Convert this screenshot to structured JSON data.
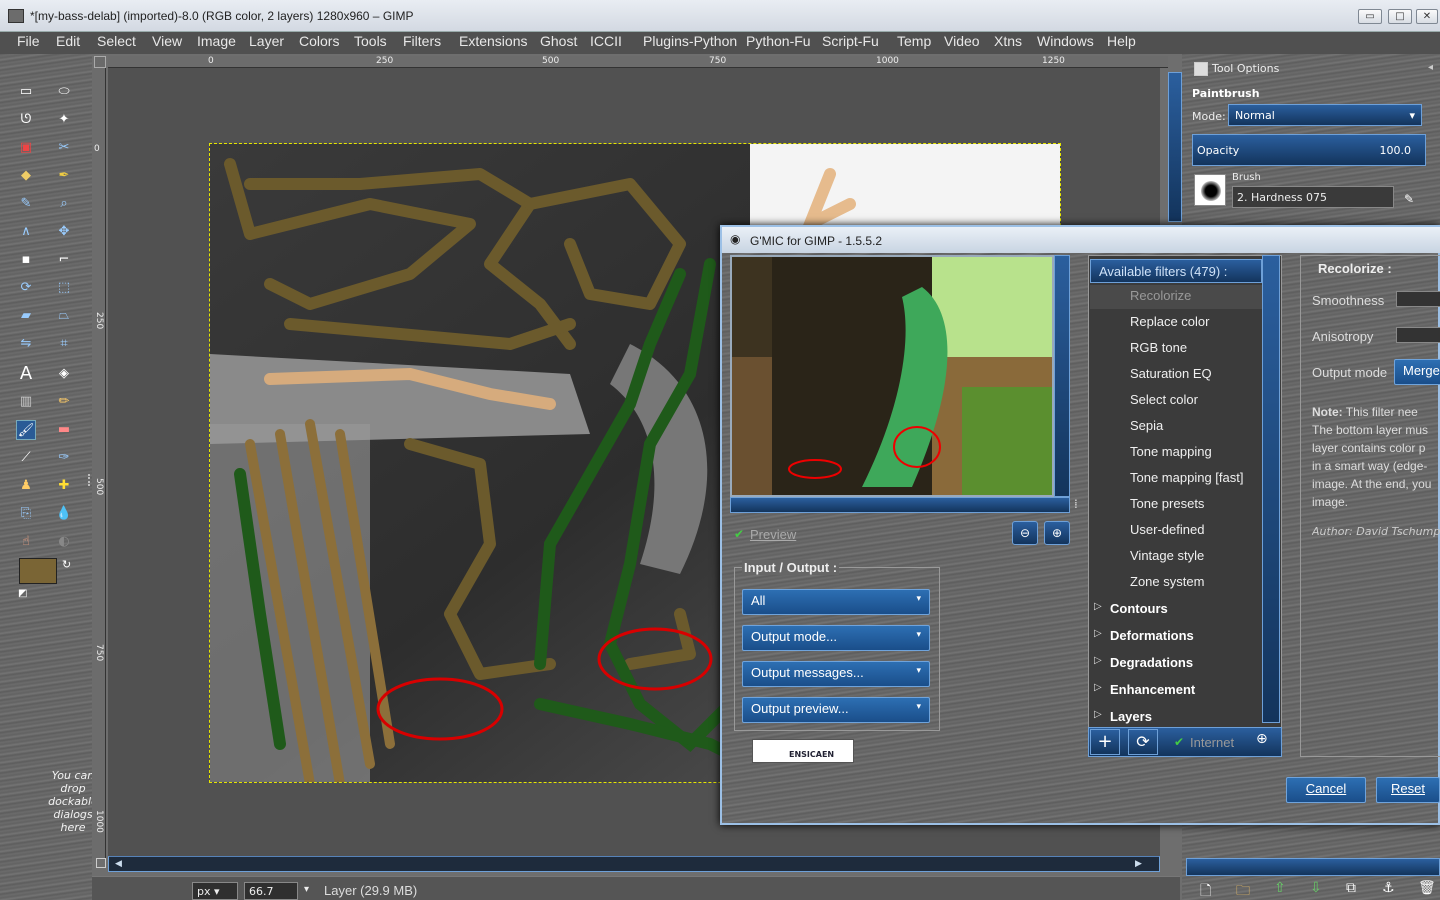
{
  "window": {
    "title": "*[my-bass-delab] (imported)-8.0 (RGB color, 2 layers) 1280x960 – GIMP",
    "min_symbol": "▭",
    "max_symbol": "□",
    "close_symbol": "✕"
  },
  "menu": [
    "File",
    "Edit",
    "Select",
    "View",
    "Image",
    "Layer",
    "Colors",
    "Tools",
    "Filters",
    "Extensions",
    "Ghost",
    "ICCII",
    "Plugins-Python",
    "Python-Fu",
    "Script-Fu",
    "Temp",
    "Video",
    "Xtns",
    "Windows",
    "Help"
  ],
  "ruler": {
    "top": [
      "0",
      "250",
      "500",
      "750",
      "1000",
      "1250"
    ],
    "left": [
      "0",
      "250",
      "500",
      "750",
      "1000"
    ]
  },
  "toolbox": {
    "dock_hint": "You can drop dockable dialogs here",
    "fg_color": "#7a6535",
    "bg_color": "#ffffff"
  },
  "status": {
    "unit": "px",
    "zoom": "66.7",
    "layer_info": "Layer (29.9 MB)"
  },
  "tool_options": {
    "header": "Tool Options",
    "tool_name": "Paintbrush",
    "mode_label": "Mode:",
    "mode_value": "Normal",
    "opacity_label": "Opacity",
    "opacity_value": "100.0",
    "brush_label": "Brush",
    "brush_value": "2. Hardness 075"
  },
  "gmic": {
    "title": "G'MIC for GIMP - 1.5.5.2",
    "preview_label": "Preview",
    "io_header": "Input / Output :",
    "io_buttons": [
      "All",
      "Output mode...",
      "Output messages...",
      "Output preview..."
    ],
    "logo_text": "ENSICAEN",
    "filters_header": "Available filters (479) :",
    "filters": [
      "Recolorize",
      "Replace color",
      "RGB tone",
      "Saturation EQ",
      "Select color",
      "Sepia",
      "Tone mapping",
      "Tone mapping [fast]",
      "Tone presets",
      "User-defined",
      "Vintage style",
      "Zone system"
    ],
    "categories": [
      "Contours",
      "Deformations",
      "Degradations",
      "Enhancement",
      "Layers"
    ],
    "internet_label": "Internet",
    "param_title": "Recolorize :",
    "params": [
      "Smoothness",
      "Anisotropy"
    ],
    "output_mode_label": "Output mode",
    "output_mode_value": "Merge",
    "note_label": "Note:",
    "note_lines": [
      " This filter nee",
      "The bottom layer mus",
      "layer contains color p",
      "in a smart way (edge-",
      "image. At the end, you",
      "image."
    ],
    "author": "Author: David Tschumpe",
    "cancel": "Cancel",
    "reset": "Reset"
  }
}
